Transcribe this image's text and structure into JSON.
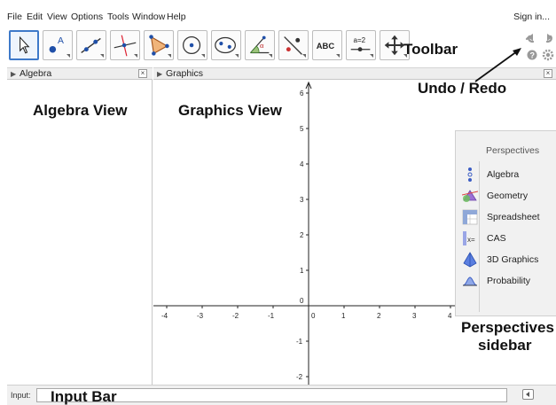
{
  "menubar": {
    "items": [
      "File",
      "Edit",
      "View",
      "Options",
      "Tools",
      "Window",
      "Help"
    ],
    "sign_in": "Sign in..."
  },
  "toolbar": {
    "tools": [
      {
        "icon": "move-arrow-icon",
        "selected": true
      },
      {
        "icon": "point-icon",
        "label": "A"
      },
      {
        "icon": "line-icon"
      },
      {
        "icon": "perpendicular-line-icon"
      },
      {
        "icon": "polygon-icon"
      },
      {
        "icon": "circle-center-point-icon"
      },
      {
        "icon": "ellipse-icon"
      },
      {
        "icon": "angle-icon",
        "label": "α"
      },
      {
        "icon": "reflect-icon"
      },
      {
        "icon": "text-icon",
        "label": "ABC"
      },
      {
        "icon": "slider-icon",
        "label": "a=2"
      },
      {
        "icon": "move-graphics-view-icon"
      }
    ],
    "annotation": "Toolbar"
  },
  "undo_redo_annotation": "Undo / Redo",
  "panels": {
    "algebra": {
      "title": "Algebra",
      "annotation": "Algebra View"
    },
    "graphics": {
      "title": "Graphics",
      "annotation": "Graphics View"
    }
  },
  "graphics_axes": {
    "x_ticks": [
      "-4",
      "-3",
      "-2",
      "-1",
      "0",
      "1",
      "2",
      "3",
      "4"
    ],
    "y_ticks": [
      "6",
      "5",
      "4",
      "3",
      "2",
      "1",
      "-1",
      "-2"
    ]
  },
  "perspectives": {
    "title": "Perspectives",
    "items": [
      {
        "label": "Algebra",
        "icon": "algebra-perspective-icon"
      },
      {
        "label": "Geometry",
        "icon": "geometry-perspective-icon"
      },
      {
        "label": "Spreadsheet",
        "icon": "spreadsheet-perspective-icon"
      },
      {
        "label": "CAS",
        "icon": "cas-perspective-icon"
      },
      {
        "label": "3D Graphics",
        "icon": "3d-graphics-perspective-icon"
      },
      {
        "label": "Probability",
        "icon": "probability-perspective-icon"
      }
    ],
    "annotation_line1": "Perspectives",
    "annotation_line2": "sidebar"
  },
  "inputbar": {
    "label": "Input:",
    "annotation": "Input Bar"
  },
  "colors": {
    "selected_border": "#3e79c9",
    "header_bg": "#eeeeee",
    "sidebar_bg": "#f1f1f1"
  }
}
